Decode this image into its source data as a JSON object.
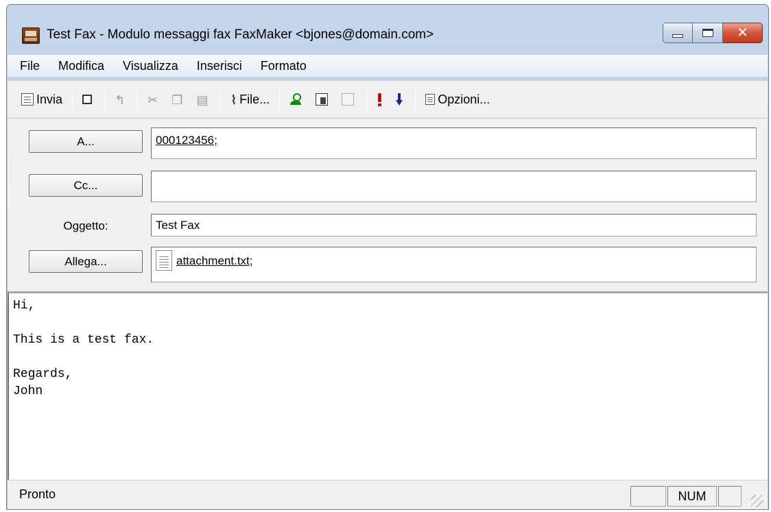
{
  "window": {
    "title": "Test Fax - Modulo messaggi fax FaxMaker <bjones@domain.com>",
    "close_glyph": "✕"
  },
  "menu": [
    "File",
    "Modifica",
    "Visualizza",
    "Inserisci",
    "Formato"
  ],
  "toolbar": {
    "send_label": "Invia",
    "attach_label": "File...",
    "options_label": "Opzioni..."
  },
  "header": {
    "to_button": "A...",
    "to_value": "000123456;",
    "cc_button": "Cc...",
    "cc_value": "",
    "subject_label": "Oggetto:",
    "subject_value": "Test Fax",
    "attach_button": "Allega...",
    "attach_value": "attachment.txt;"
  },
  "message": {
    "body": "Hi,\n\nThis is a test fax.\n\nRegards,\nJohn"
  },
  "status": {
    "text": "Pronto",
    "num": "NUM"
  }
}
